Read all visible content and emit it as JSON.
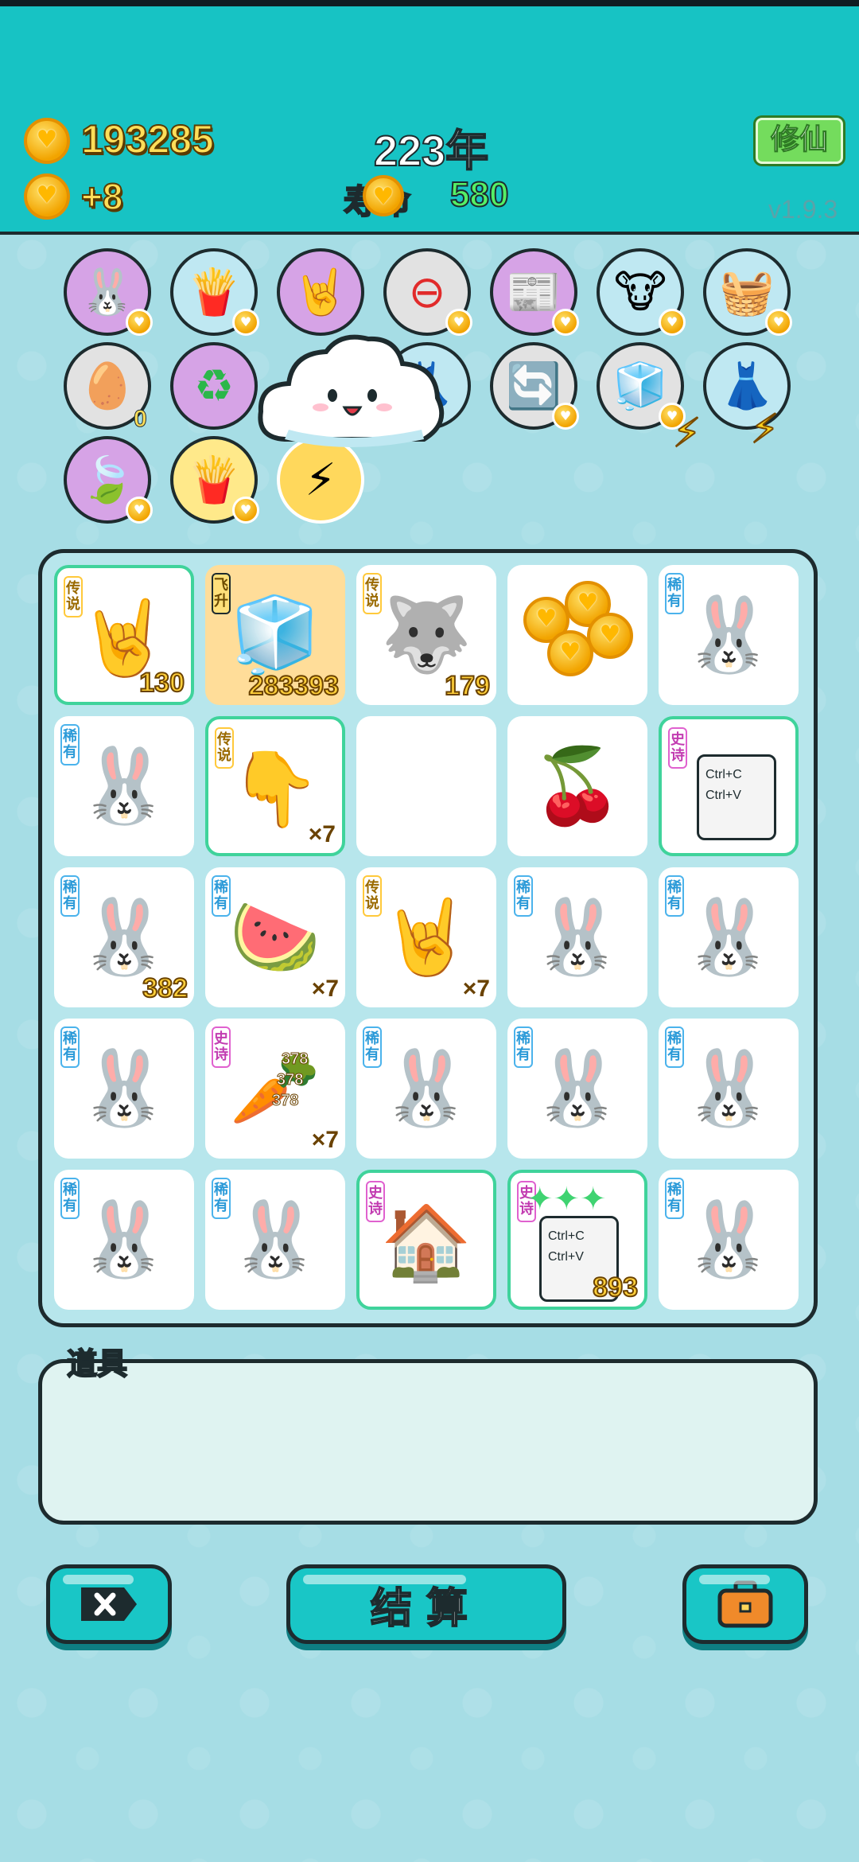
{
  "header": {
    "coins": "193285",
    "income": "+8",
    "year": "223年",
    "life_label": "寿命",
    "life_value": "580",
    "cultivate_button": "修仙",
    "version": "v1.9.3"
  },
  "abilities": {
    "counts": [
      "0"
    ]
  },
  "board": {
    "rarity_legend": "传说",
    "rarity_rare": "稀有",
    "rarity_epic": "史诗",
    "rarity_fly": "飞升",
    "values": {
      "r1c1": "130",
      "r1c2": "283393",
      "r1c3": "179",
      "r2c2": "×7",
      "r3c1": "382",
      "r3c2": "×7",
      "r3c3": "×7",
      "r4c2": "×7",
      "r4c2_coin": "378",
      "r5c4": "893"
    },
    "copy_paste_top": "Ctrl+C",
    "copy_paste_bottom": "Ctrl+V"
  },
  "props": {
    "title": "道具"
  },
  "buttons": {
    "settle": "结算"
  },
  "colors": {
    "header_bg": "#17c3c4",
    "page_bg": "#a6dde5",
    "legendary_border": "#3fd39b",
    "button_bg": "#19c6c6"
  }
}
